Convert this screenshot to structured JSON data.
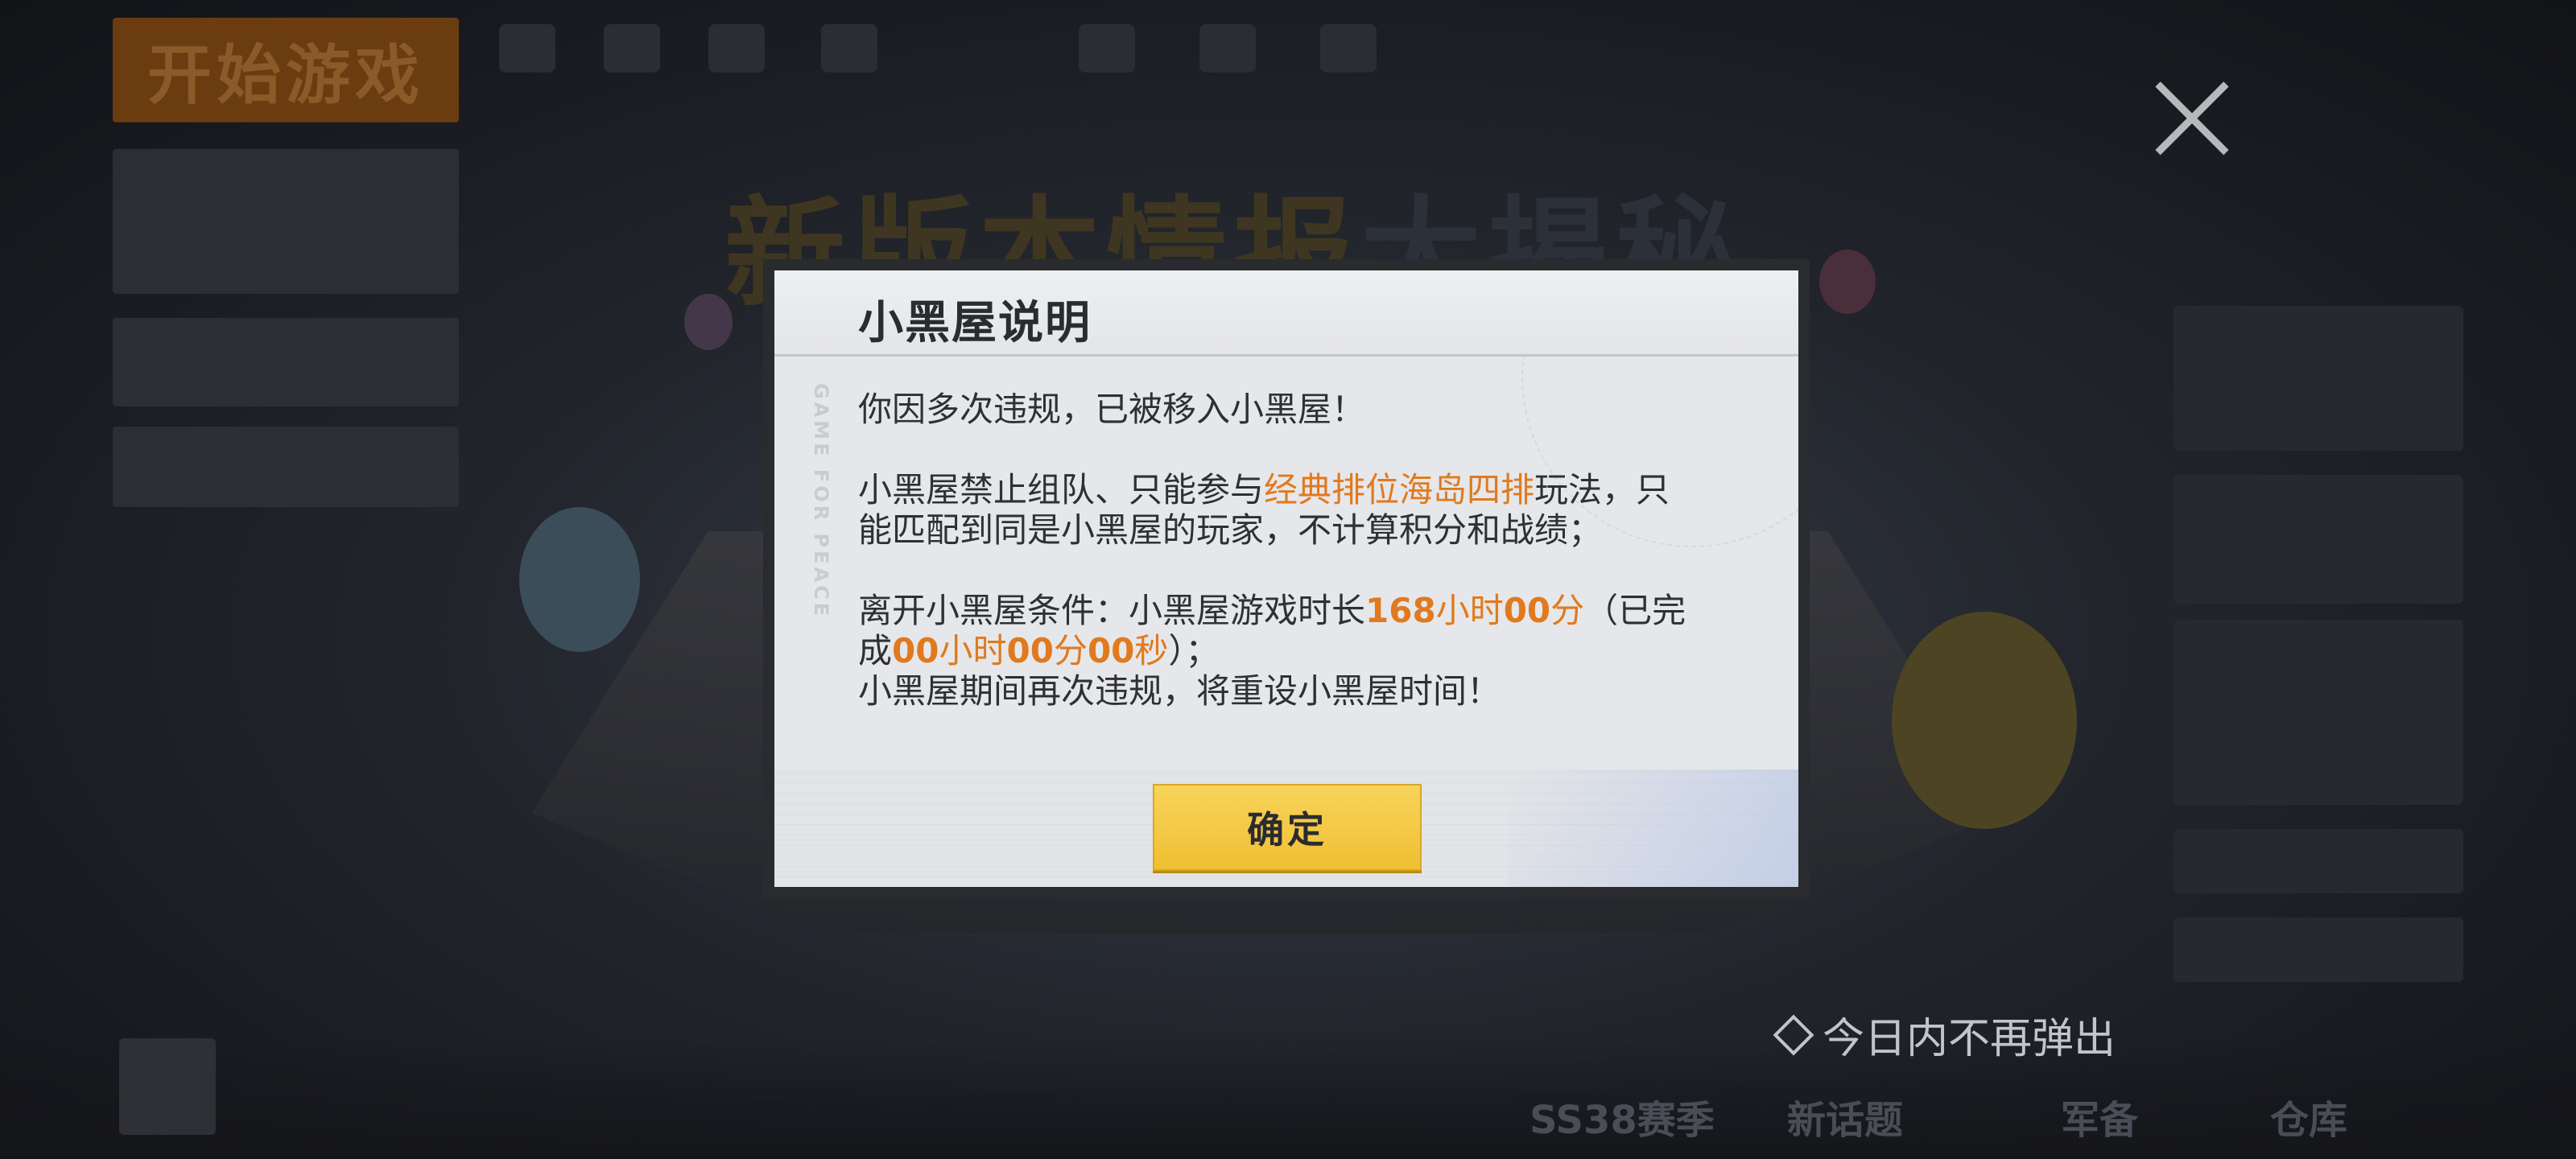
{
  "background": {
    "start_button_label": "开始游戏",
    "banner_text_1": "新版本情报",
    "banner_text_2": "大揭秘",
    "bottom_items": [
      "SS38赛季",
      "新话题",
      "军备",
      "仓库"
    ]
  },
  "overlay": {
    "no_popup_today": "今日内不再弹出"
  },
  "modal": {
    "title": "小黑屋说明",
    "watermark": "GAME FOR PEACE",
    "line1": "你因多次违规，已被移入小黑屋！",
    "p2_pre": "小黑屋禁止组队、只能参与",
    "p2_highlight": "经典排位海岛四排",
    "p2_post": "玩法，只能匹配到同是小黑屋的玩家，不计算积分和战绩；",
    "p3_pre": "离开小黑屋条件：小黑屋游戏时长",
    "p3_duration_num1": "168",
    "p3_duration_unit1": "小时",
    "p3_duration_num2": "00",
    "p3_duration_unit2": "分",
    "p3_mid": "（已完成",
    "p3_progress_num1": "00",
    "p3_progress_unit1": "小时",
    "p3_progress_num2": "00",
    "p3_progress_unit2": "分",
    "p3_progress_num3": "00",
    "p3_progress_unit3": "秒",
    "p3_end": "）；",
    "line4": "小黑屋期间再次违规，将重设小黑屋时间！",
    "confirm_label": "确定"
  },
  "colors": {
    "highlight": "#e07a1f",
    "button": "#f2c53d",
    "modal_bg": "#e6e7ea"
  }
}
